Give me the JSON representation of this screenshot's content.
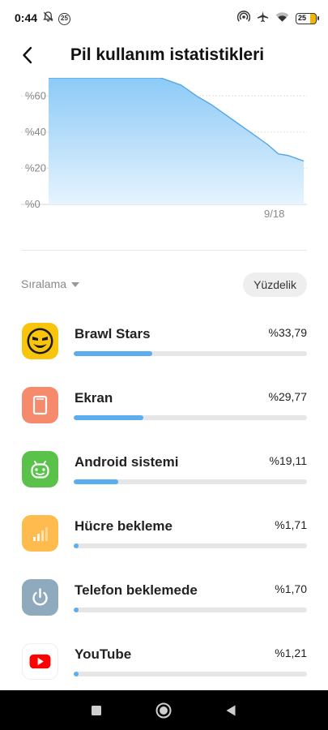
{
  "status_bar": {
    "time": "0:44",
    "notification_count": "25",
    "battery_level": "25",
    "icons": [
      "bell-off-icon",
      "hotspot-icon",
      "airplane-icon",
      "wifi-icon",
      "battery-icon"
    ]
  },
  "header": {
    "title": "Pil kullanım istatistikleri",
    "back_icon": "back-arrow-icon"
  },
  "chart_data": {
    "type": "area",
    "y_ticks": [
      "%60",
      "%40",
      "%20",
      "%0"
    ],
    "ylim": [
      0,
      70
    ],
    "x_tick": "9/18",
    "series": [
      {
        "x": [
          0,
          0.44,
          0.52,
          0.58,
          0.64,
          0.7,
          0.76,
          0.82,
          0.86,
          0.9,
          0.94,
          1.0
        ],
        "y": [
          73,
          73,
          66,
          60,
          55,
          49,
          43,
          37,
          33,
          28,
          27,
          24
        ]
      }
    ],
    "fill_color": "#9fd1f7",
    "line_color": "#4ea3e6",
    "grid": "dashed horizontal"
  },
  "sort": {
    "label": "Sıralama",
    "mode_button": "Yüzdelik"
  },
  "apps": [
    {
      "name": "Brawl Stars",
      "value": "%33,79",
      "fraction": 0.3379,
      "icon": "brawl-stars-icon",
      "icon_color": "#f8c40c"
    },
    {
      "name": "Ekran",
      "value": "%29,77",
      "fraction": 0.2977,
      "icon": "screen-icon",
      "icon_color": "#f68a6d"
    },
    {
      "name": "Android sistemi",
      "value": "%19,11",
      "fraction": 0.1911,
      "icon": "android-icon",
      "icon_color": "#5ac24a"
    },
    {
      "name": "Hücre bekleme",
      "value": "%1,71",
      "fraction": 0.0171,
      "icon": "signal-icon",
      "icon_color": "#ffbb4d"
    },
    {
      "name": "Telefon beklemede",
      "value": "%1,70",
      "fraction": 0.017,
      "icon": "power-icon",
      "icon_color": "#8fa9bd"
    },
    {
      "name": "YouTube",
      "value": "%1,21",
      "fraction": 0.0121,
      "icon": "youtube-icon",
      "icon_color": "#ff0000"
    }
  ],
  "nav": {
    "icons": [
      "recent-apps-icon",
      "home-icon",
      "back-icon"
    ]
  }
}
